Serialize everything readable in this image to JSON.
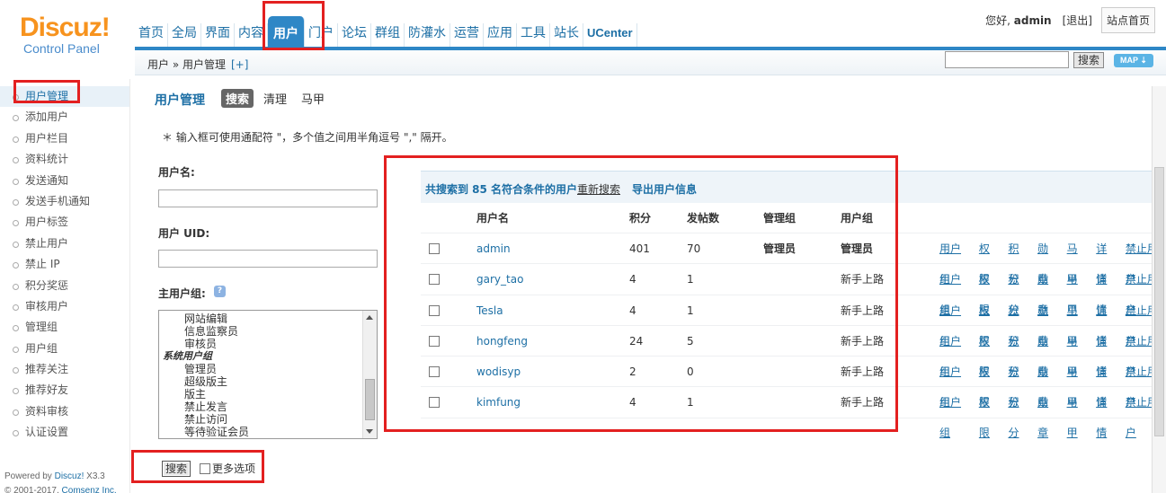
{
  "logo": {
    "brand": "Discuz!",
    "subtitle": "Control Panel"
  },
  "topnav": {
    "items": [
      "首页",
      "全局",
      "界面",
      "内容",
      "用户",
      "门户",
      "论坛",
      "群组",
      "防灌水",
      "运营",
      "应用",
      "工具",
      "站长",
      "UCenter"
    ],
    "active_index": 4
  },
  "header_right": {
    "greeting_prefix": "您好,",
    "username": "admin",
    "logout": "[退出]",
    "site_home": "站点首页"
  },
  "breadcrumb": {
    "text": "用户 » 用户管理",
    "plus": "[+]"
  },
  "header_search": {
    "value": "",
    "button": "搜索",
    "map": "MAP ⇣"
  },
  "sidemenu": {
    "items": [
      "用户管理",
      "添加用户",
      "用户栏目",
      "资料统计",
      "发送通知",
      "发送手机通知",
      "用户标签",
      "禁止用户",
      "禁止 IP",
      "积分奖惩",
      "审核用户",
      "管理组",
      "用户组",
      "推荐关注",
      "推荐好友",
      "资料审核",
      "认证设置"
    ],
    "active_index": 0,
    "powered_prefix": "Powered by",
    "powered_brand": "Discuz!",
    "powered_version": "X3.3",
    "copyright_prefix": "© 2001-2017,",
    "copyright_company": "Comsenz Inc."
  },
  "main": {
    "title": "用户管理",
    "tabs": [
      "搜索",
      "清理",
      "马甲"
    ],
    "active_tab": 0,
    "tip": "＊ 输入框可使用通配符 \"，多个值之间用半角逗号 \",\" 隔开。",
    "username_label": "用户名:",
    "username_value": "",
    "uid_label": "用户 UID:",
    "uid_value": "",
    "group_label": "主用户组:",
    "group_options": [
      {
        "type": "opt",
        "label": "网站编辑"
      },
      {
        "type": "opt",
        "label": "信息监察员"
      },
      {
        "type": "opt",
        "label": "审核员"
      },
      {
        "type": "group",
        "label": "系统用户组"
      },
      {
        "type": "opt",
        "label": "管理员"
      },
      {
        "type": "opt",
        "label": "超级版主"
      },
      {
        "type": "opt",
        "label": "版主"
      },
      {
        "type": "opt",
        "label": "禁止发言"
      },
      {
        "type": "opt",
        "label": "禁止访问"
      },
      {
        "type": "opt",
        "label": "等待验证会员"
      }
    ],
    "submit": "搜索",
    "more_options": "更多选项"
  },
  "results": {
    "count_text": "共搜索到 85 名符合条件的用户",
    "research": "重新搜索",
    "export": "导出用户信息",
    "columns": [
      "用户名",
      "积分",
      "发帖数",
      "管理组",
      "用户组"
    ],
    "actions": [
      "用户组",
      "权限",
      "积分",
      "勋章",
      "马甲",
      "详情",
      "禁止用户"
    ],
    "rows": [
      {
        "username": "admin",
        "credits": "401",
        "posts": "70",
        "admin_group": "管理员",
        "user_group": "管理员",
        "bold_groups": true
      },
      {
        "username": "gary_tao",
        "credits": "4",
        "posts": "1",
        "admin_group": "",
        "user_group": "新手上路",
        "bold_groups": false
      },
      {
        "username": "Tesla",
        "credits": "4",
        "posts": "1",
        "admin_group": "",
        "user_group": "新手上路",
        "bold_groups": false
      },
      {
        "username": "hongfeng",
        "credits": "24",
        "posts": "5",
        "admin_group": "",
        "user_group": "新手上路",
        "bold_groups": false
      },
      {
        "username": "wodisyp",
        "credits": "2",
        "posts": "0",
        "admin_group": "",
        "user_group": "新手上路",
        "bold_groups": false
      },
      {
        "username": "kimfung",
        "credits": "4",
        "posts": "1",
        "admin_group": "",
        "user_group": "新手上路",
        "bold_groups": false
      }
    ]
  },
  "colors": {
    "accent": "#2e87c6",
    "link": "#1d6fa5",
    "logo": "#f7931e",
    "annotation": "#e32020"
  }
}
